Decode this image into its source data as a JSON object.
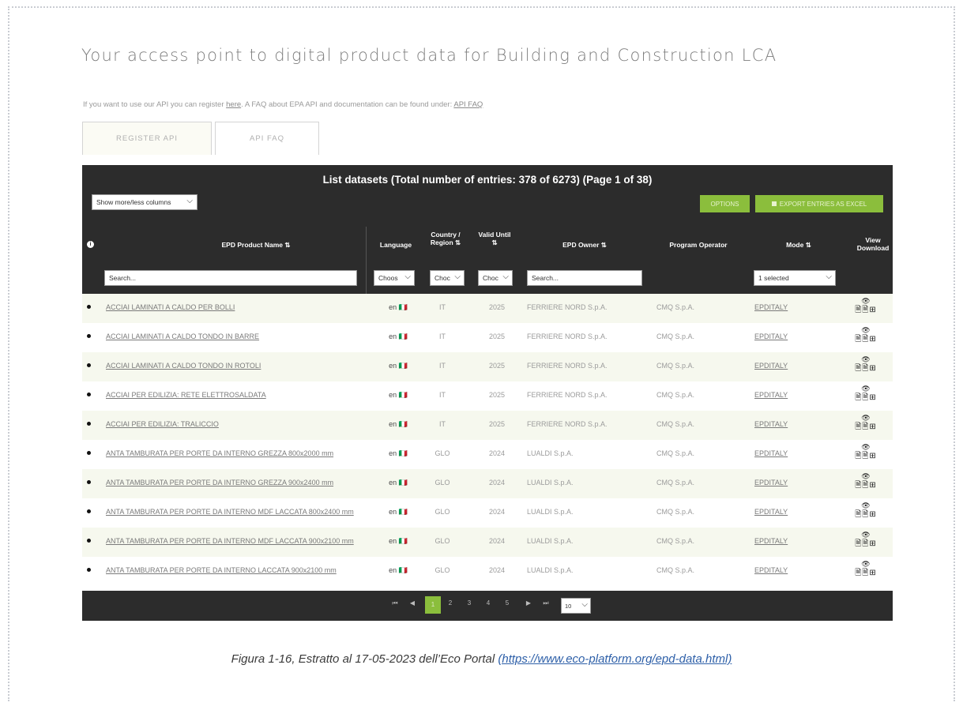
{
  "headline": "Your access point to digital product data for Building and Construction LCA",
  "info": {
    "text_before": "If you want to use our API you can register",
    "here_link": "here",
    "text_middle": ". A FAQ about EPA API and documentation can be found under:",
    "faq_link": "API FAQ"
  },
  "tabs": [
    {
      "label": "REGISTER API"
    },
    {
      "label": "API FAQ"
    }
  ],
  "table": {
    "title": "List datasets (Total number of entries: 378 of 6273) (Page 1 of 38)",
    "columns_select": "Show more/less columns",
    "options_button": "OPTIONS",
    "export_button": "EXPORT ENTRIES AS EXCEL",
    "headers": {
      "product": "EPD Product Name ⇅",
      "language": "Language",
      "country": "Country / Region ⇅",
      "valid": "Valid Until ⇅",
      "owner": "EPD Owner ⇅",
      "operator": "Program Operator",
      "mode": "Mode ⇅",
      "view": "View Download"
    },
    "filters": {
      "product": "Search...",
      "language": "Choos",
      "country": "Choc",
      "valid": "Choc",
      "owner": "Search...",
      "mode": "1 selected"
    },
    "rows": [
      {
        "name": "ACCIAI LAMINATI A CALDO PER BOLLI",
        "lang": "en 🇮🇹",
        "country": "IT",
        "valid": "2025",
        "owner": "FERRIERE NORD S.p.A.",
        "operator": "CMQ S.p.A.",
        "mode": "EPDITALY"
      },
      {
        "name": "ACCIAI LAMINATI A CALDO TONDO IN BARRE",
        "lang": "en 🇮🇹",
        "country": "IT",
        "valid": "2025",
        "owner": "FERRIERE NORD S.p.A.",
        "operator": "CMQ S.p.A.",
        "mode": "EPDITALY"
      },
      {
        "name": "ACCIAI LAMINATI A CALDO TONDO IN ROTOLI",
        "lang": "en 🇮🇹",
        "country": "IT",
        "valid": "2025",
        "owner": "FERRIERE NORD S.p.A.",
        "operator": "CMQ S.p.A.",
        "mode": "EPDITALY"
      },
      {
        "name": "ACCIAI PER EDILIZIA: RETE ELETTROSALDATA",
        "lang": "en 🇮🇹",
        "country": "IT",
        "valid": "2025",
        "owner": "FERRIERE NORD S.p.A.",
        "operator": "CMQ S.p.A.",
        "mode": "EPDITALY"
      },
      {
        "name": "ACCIAI PER EDILIZIA: TRALICCIO",
        "lang": "en 🇮🇹",
        "country": "IT",
        "valid": "2025",
        "owner": "FERRIERE NORD S.p.A.",
        "operator": "CMQ S.p.A.",
        "mode": "EPDITALY"
      },
      {
        "name": "ANTA TAMBURATA PER PORTE DA INTERNO GREZZA 800x2000 mm",
        "lang": "en 🇮🇹",
        "country": "GLO",
        "valid": "2024",
        "owner": "LUALDI S.p.A.",
        "operator": "CMQ S.p.A.",
        "mode": "EPDITALY"
      },
      {
        "name": "ANTA TAMBURATA PER PORTE DA INTERNO GREZZA 900x2400 mm",
        "lang": "en 🇮🇹",
        "country": "GLO",
        "valid": "2024",
        "owner": "LUALDI S.p.A.",
        "operator": "CMQ S.p.A.",
        "mode": "EPDITALY"
      },
      {
        "name": "ANTA TAMBURATA PER PORTE DA INTERNO MDF LACCATA 800x2400 mm",
        "lang": "en 🇮🇹",
        "country": "GLO",
        "valid": "2024",
        "owner": "LUALDI S.p.A.",
        "operator": "CMQ S.p.A.",
        "mode": "EPDITALY"
      },
      {
        "name": "ANTA TAMBURATA PER PORTE DA INTERNO MDF LACCATA 900x2100 mm",
        "lang": "en 🇮🇹",
        "country": "GLO",
        "valid": "2024",
        "owner": "LUALDI S.p.A.",
        "operator": "CMQ S.p.A.",
        "mode": "EPDITALY"
      },
      {
        "name": "ANTA TAMBURATA PER PORTE DA INTERNO LACCATA 900x2100 mm",
        "lang": "en 🇮🇹",
        "country": "GLO",
        "valid": "2024",
        "owner": "LUALDI S.p.A.",
        "operator": "CMQ S.p.A.",
        "mode": "EPDITALY"
      }
    ],
    "row_actions": {
      "view_icon": "👁",
      "download_icons": "🗎🗎⊞"
    }
  },
  "pager": {
    "first": "⏮",
    "prev": "◀",
    "pages": [
      "1",
      "2",
      "3",
      "4",
      "5"
    ],
    "active_page": "1",
    "next": "▶",
    "last": "⏭",
    "page_size": "10"
  },
  "caption": {
    "text": "Figura 1-16, Estratto al 17-05-2023 dell’Eco Portal",
    "url": "(https://www.eco-platform.org/epd-data.html)"
  },
  "colors": {
    "header_bg": "#2c2c2c",
    "accent_green": "#8bbe3c",
    "row_alt": "#f6f8ee"
  }
}
